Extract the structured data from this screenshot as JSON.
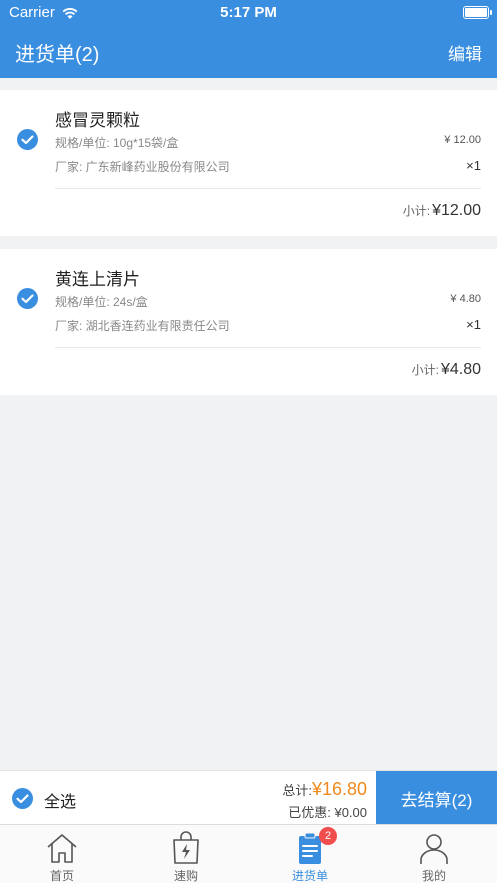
{
  "status_bar": {
    "carrier": "Carrier",
    "time": "5:17 PM"
  },
  "nav": {
    "title": "进货单(2)",
    "edit": "编辑"
  },
  "items": [
    {
      "name": "感冒灵颗粒",
      "spec": "规格/单位: 10g*15袋/盒",
      "price": "¥ 12.00",
      "maker": "厂家: 广东新峰药业股份有限公司",
      "qty": "×1",
      "subtotal_label": "小计:",
      "subtotal": "¥12.00",
      "checked": true
    },
    {
      "name": "黄连上清片",
      "spec": "规格/单位: 24s/盒",
      "price": "¥ 4.80",
      "maker": "厂家: 湖北香连药业有限责任公司",
      "qty": "×1",
      "subtotal_label": "小计:",
      "subtotal": "¥4.80",
      "checked": true
    }
  ],
  "footer": {
    "select_all": "全选",
    "total_label": "总计:",
    "total": "¥16.80",
    "discount": "已优惠: ¥0.00",
    "checkout": "去结算(2)"
  },
  "tabs": [
    {
      "label": "首页",
      "icon": "home-icon"
    },
    {
      "label": "速购",
      "icon": "quick-buy-bag-icon"
    },
    {
      "label": "进货单",
      "icon": "order-list-icon",
      "badge": "2",
      "active": true
    },
    {
      "label": "我的",
      "icon": "person-icon"
    }
  ],
  "colors": {
    "accent": "#3a8ee0",
    "total": "#f08a1c",
    "badge": "#f24d4d"
  }
}
